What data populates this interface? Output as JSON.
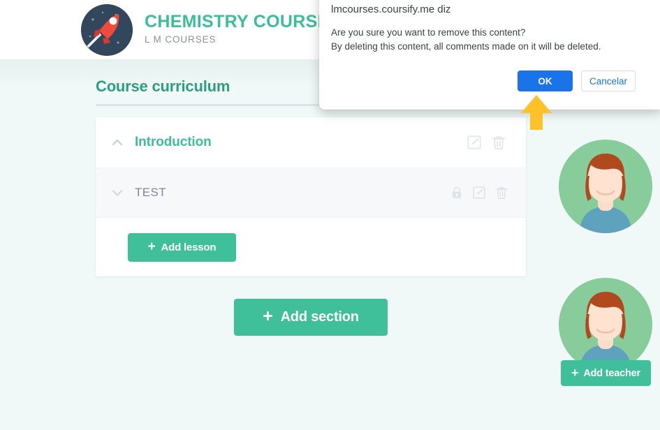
{
  "header": {
    "logo_icon": "rocket-logo-icon",
    "course_title": "CHEMISTRY COURSE",
    "course_subtitle": "L M COURSES"
  },
  "main": {
    "page_title": "Course curriculum",
    "sections": [
      {
        "title": "Introduction",
        "collapse_icon": "chevron-up-icon",
        "actions": [
          "edit-icon",
          "trash-icon"
        ],
        "lessons": [
          {
            "title": "TEST",
            "collapse_icon": "chevron-down-icon",
            "actions": [
              "lock-icon",
              "edit-icon",
              "trash-icon"
            ]
          }
        ],
        "add_lesson_label": "Add lesson"
      }
    ],
    "add_section_label": "Add section",
    "add_teacher_label": "Add teacher",
    "plus_glyph": "+"
  },
  "teachers": [
    {
      "avatar_name": "teacher-avatar"
    },
    {
      "avatar_name": "teacher-avatar"
    }
  ],
  "dialog": {
    "origin": "lmcourses.coursify.me diz",
    "message_line_1": "Are you sure you want to remove this content?",
    "message_line_2": "By deleting this content, all comments made on it will be deleted.",
    "ok_label": "OK",
    "cancel_label": "Cancelar"
  },
  "annotation": {
    "pointer_icon": "up-arrow-pointer"
  },
  "colors": {
    "brand_green": "#3cbe99",
    "heading_green": "#2f9e7e",
    "button_green": "#3fc09a",
    "dialog_blue": "#1a73e8",
    "arrow_yellow": "#fdc12a",
    "page_background": "#f0f9f7",
    "lesson_row_background": "#f7f8f9",
    "lesson_text": "#7d86a1"
  }
}
